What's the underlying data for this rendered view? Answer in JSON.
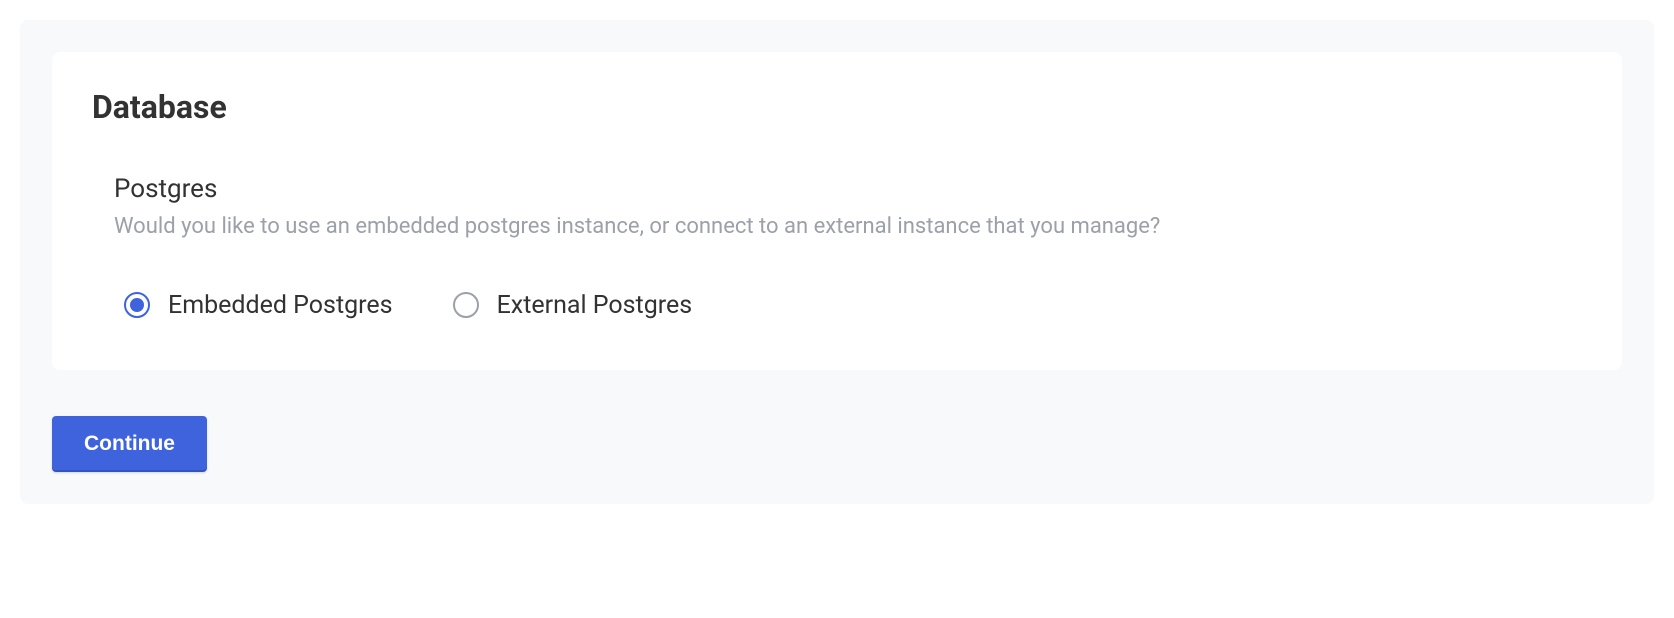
{
  "card": {
    "title": "Database"
  },
  "section": {
    "title": "Postgres",
    "description": "Would you like to use an embedded postgres instance, or connect to an external instance that you manage?"
  },
  "options": {
    "embedded": {
      "label": "Embedded Postgres",
      "selected": true
    },
    "external": {
      "label": "External Postgres",
      "selected": false
    }
  },
  "actions": {
    "continue_label": "Continue"
  }
}
